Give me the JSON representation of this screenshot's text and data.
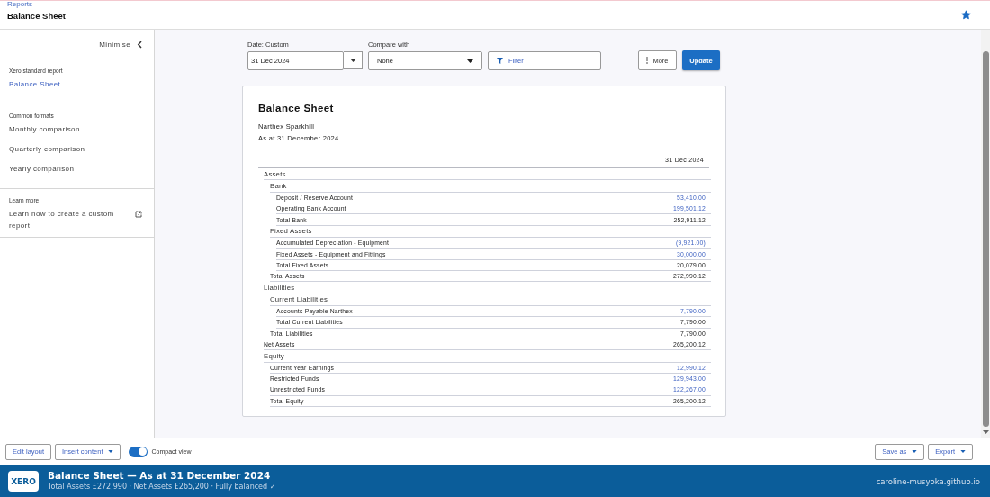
{
  "header": {
    "breadcrumb": "Reports",
    "title": "Balance Sheet",
    "starred": true
  },
  "sidebar": {
    "minimise": "Minimise",
    "sections": [
      {
        "heading": "Xero standard report",
        "items": [
          {
            "label": "Balance Sheet",
            "selected": true,
            "external": false
          }
        ]
      },
      {
        "heading": "Common formats",
        "items": [
          {
            "label": "Monthly comparison",
            "selected": false,
            "external": false
          },
          {
            "label": "Quarterly comparison",
            "selected": false,
            "external": false
          },
          {
            "label": "Yearly comparison",
            "selected": false,
            "external": false
          }
        ]
      },
      {
        "heading": "Learn more",
        "items": [
          {
            "label": "Learn how to create a custom report",
            "selected": false,
            "external": true
          }
        ]
      }
    ]
  },
  "controls": {
    "date_label": "Date: Custom",
    "date_value": "31 Dec 2024",
    "compare_label": "Compare with",
    "compare_value": "None",
    "filter": "Filter",
    "more": "More",
    "update": "Update"
  },
  "report": {
    "title": "Balance Sheet",
    "organisation": "Narthex Sparkhill",
    "as_at": "As at 31 December 2024",
    "column": "31 Dec 2024",
    "rows": [
      {
        "label": "Assets",
        "children": [
          {
            "label": "Bank",
            "children": [
              {
                "label": "Deposit / Reserve Account",
                "value": "53,410.00",
                "linked": true
              },
              {
                "label": "Operating Bank Account",
                "value": "199,501.12",
                "linked": true
              },
              {
                "label": "Total Bank",
                "value": "252,911.12",
                "linked": false
              }
            ]
          },
          {
            "label": "Fixed Assets",
            "children": [
              {
                "label": "Accumulated Depreciation - Equipment",
                "value": "(9,921.00)",
                "linked": true
              },
              {
                "label": "Fixed Assets - Equipment and Fittings",
                "value": "30,000.00",
                "linked": true
              },
              {
                "label": "Total Fixed Assets",
                "value": "20,079.00",
                "linked": false
              }
            ]
          },
          {
            "label": "Total Assets",
            "value": "272,990.12",
            "linked": false
          }
        ]
      },
      {
        "label": "Liabilities",
        "children": [
          {
            "label": "Current Liabilities",
            "children": [
              {
                "label": "Accounts Payable Narthex",
                "value": "7,790.00",
                "linked": true
              },
              {
                "label": "Total Current Liabilities",
                "value": "7,790.00",
                "linked": false
              }
            ]
          },
          {
            "label": "Total Liabilities",
            "value": "7,790.00",
            "linked": false
          }
        ]
      },
      {
        "label": "Net Assets",
        "value": "265,200.12",
        "linked": false
      },
      {
        "label": "Equity",
        "children": [
          {
            "label": "Current Year Earnings",
            "value": "12,990.12",
            "linked": true
          },
          {
            "label": "Restricted Funds",
            "value": "129,943.00",
            "linked": true
          },
          {
            "label": "Unrestricted Funds",
            "value": "122,267.00",
            "linked": true
          },
          {
            "label": "Total Equity",
            "value": "265,200.12",
            "linked": false
          }
        ]
      }
    ]
  },
  "toolbar": {
    "edit_layout": "Edit layout",
    "insert_content": "Insert content",
    "compact_view": {
      "label": "Compact view",
      "on": true
    },
    "save_as": "Save as",
    "export": "Export"
  },
  "banner": {
    "logo": "XERO",
    "title": "Balance Sheet — As at 31 December 2024",
    "summary": "Total Assets £272,990 · Net Assets £265,200 · Fully balanced ✓",
    "site": "caroline-musyoka.github.io"
  }
}
